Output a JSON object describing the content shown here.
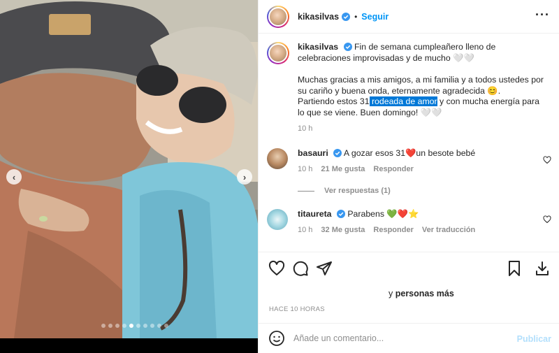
{
  "post": {
    "author": "kikasilvas",
    "follow_label": "Seguir",
    "separator": "•",
    "more_icon": "more-horizontal-icon",
    "carousel": {
      "dot_count": 10,
      "active_index": 4
    }
  },
  "caption": {
    "author": "kikasilvas",
    "text_1": "Fin de semana cumpleañero lleno de celebraciones improvisadas y de mucho 🤍🤍",
    "text_2": "Muchas gracias a mis amigos, a mi familia y a todos ustedes por su cariño y buena onda, eternamente agradecida 😊.",
    "text_3a": "Partiendo estos 31",
    "text_3_highlight": " rodeada de amor",
    "text_3b": " y con mucha energía para lo que se viene. Buen domingo! 🤍🤍",
    "time": "10 h"
  },
  "comments": [
    {
      "user": "basauri",
      "text_a": "A gozar esos 31",
      "emoji": "❤️",
      "text_b": "un besote bebé",
      "time": "10 h",
      "likes": "21 Me gusta",
      "reply": "Responder"
    },
    {
      "user": "titaureta",
      "text_a": "Parabens ",
      "emoji": "💚❤️⭐",
      "time": "10 h",
      "likes": "32 Me gusta",
      "reply": "Responder",
      "translate": "Ver traducción"
    }
  ],
  "view_replies": "Ver respuestas (1)",
  "likes_line": {
    "prefix": "y ",
    "bold": "personas más"
  },
  "timestamp": "HACE 10 HORAS",
  "add_comment": {
    "placeholder": "Añade un comentario...",
    "publish": "Publicar"
  },
  "colors": {
    "link": "#0095f6",
    "publish_disabled": "#b2dffc",
    "verified": "#3897f0",
    "muted": "#8e8e8e"
  }
}
